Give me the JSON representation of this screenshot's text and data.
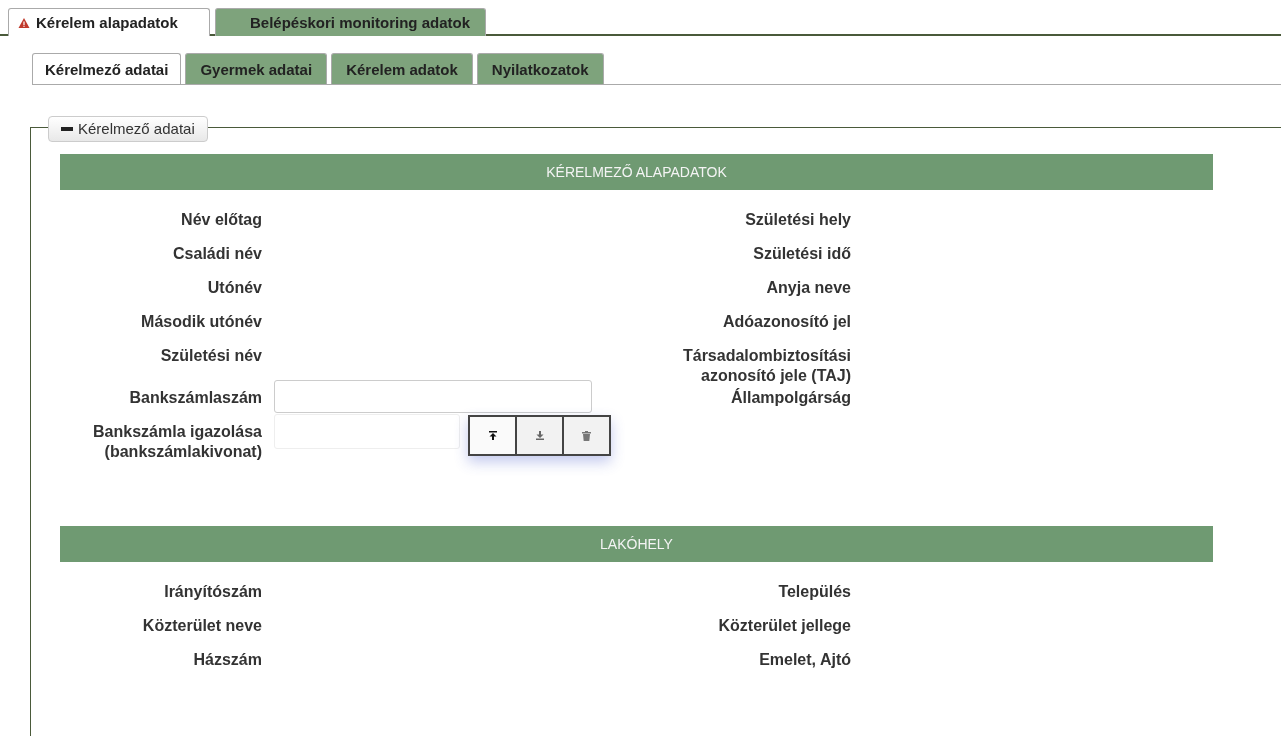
{
  "tabs": [
    {
      "label": "Kérelem alapadatok",
      "selected": true,
      "warning": true
    },
    {
      "label": "Belépéskori monitoring adatok",
      "selected": false,
      "warning": false
    }
  ],
  "subtabs": [
    {
      "label": "Kérelmező adatai",
      "selected": true
    },
    {
      "label": "Gyermek adatai",
      "selected": false
    },
    {
      "label": "Kérelem adatok",
      "selected": false
    },
    {
      "label": "Nyilatkozatok",
      "selected": false
    }
  ],
  "panel": {
    "legend": "Kérelmező adatai",
    "expanded": true,
    "sections": [
      {
        "title": "KÉRELMEZŐ ALAPADATOK",
        "rows": [
          {
            "left": {
              "label": "Név előtag",
              "kind": "text"
            },
            "right": {
              "label": "Születési hely"
            }
          },
          {
            "left": {
              "label": "Családi név",
              "kind": "text"
            },
            "right": {
              "label": "Születési idő"
            }
          },
          {
            "left": {
              "label": "Utónév",
              "kind": "text"
            },
            "right": {
              "label": "Anyja neve"
            }
          },
          {
            "left": {
              "label": "Második utónév",
              "kind": "text"
            },
            "right": {
              "label": "Adóazonosító jel"
            }
          },
          {
            "left": {
              "label": "Születési név",
              "kind": "text"
            },
            "right": {
              "label": "Társadalombiztosítási azonosító jele (TAJ)"
            }
          },
          {
            "left": {
              "label": "Bankszámlaszám",
              "kind": "input"
            },
            "right": {
              "label": "Állampolgárság"
            }
          },
          {
            "left": {
              "label": "Bankszámla igazolása (bankszámlakivonat)",
              "kind": "file"
            }
          }
        ]
      },
      {
        "title": "LAKÓHELY",
        "rows": [
          {
            "left": {
              "label": "Irányítószám",
              "kind": "text"
            },
            "right": {
              "label": "Település"
            }
          },
          {
            "left": {
              "label": "Közterület neve",
              "kind": "text"
            },
            "right": {
              "label": "Közterület jellege"
            }
          },
          {
            "left": {
              "label": "Házszám",
              "kind": "text"
            },
            "right": {
              "label": "Emelet, Ajtó"
            }
          }
        ]
      }
    ]
  }
}
